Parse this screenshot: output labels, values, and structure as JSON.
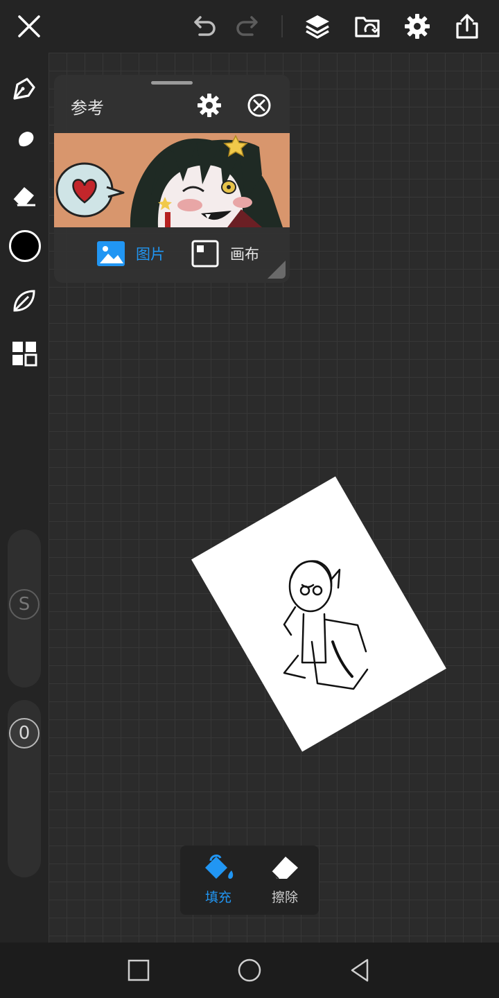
{
  "colors": {
    "accent": "#2196f3",
    "toolbar_bg": "#242424",
    "icon": "#ffffff",
    "icon_dim": "#8a8a8a",
    "current_brush_color": "#000000"
  },
  "top_toolbar": {
    "close_icon": "close-icon",
    "undo_icon": "undo-icon",
    "redo_icon": "redo-icon",
    "layers_icon": "layers-icon",
    "gallery_icon": "gallery-icon",
    "settings_icon": "gear-icon",
    "share_icon": "share-icon"
  },
  "left_toolbar": {
    "tools": [
      "brush-icon",
      "smudge-icon",
      "eraser-icon",
      "color-swatch",
      "leaf-icon",
      "grid-icon"
    ],
    "size_slider_label": "S",
    "opacity_slider_label": "0"
  },
  "reference_panel": {
    "title": "参考",
    "tab_image_label": "图片",
    "tab_canvas_label": "画布",
    "active_tab": "图片"
  },
  "fill_bar": {
    "fill_label": "填充",
    "erase_label": "擦除",
    "active": "填充"
  },
  "system_nav": {
    "recents": "square-icon",
    "home": "circle-icon",
    "back": "triangle-back-icon"
  }
}
